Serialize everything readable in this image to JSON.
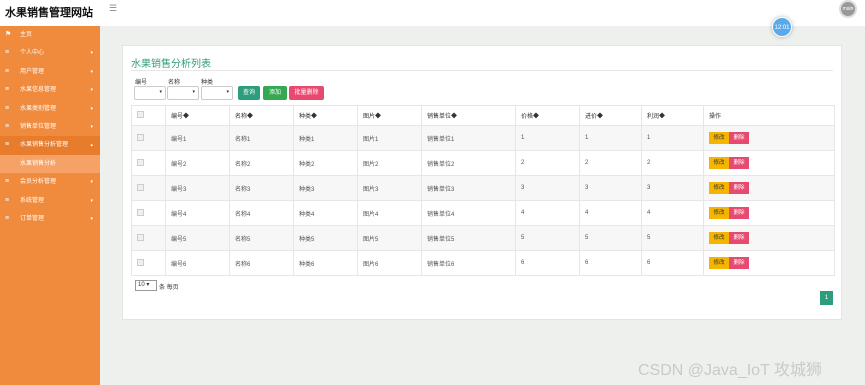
{
  "app": {
    "title": "水果销售管理网站",
    "menu_icon": "hamburger-icon"
  },
  "header": {
    "avatar_text": "main"
  },
  "clock": {
    "text": "12:01"
  },
  "sidebar": {
    "items": [
      {
        "icon": "flag-icon",
        "label": "主页",
        "has_arrow": false
      },
      {
        "icon": "list-icon",
        "label": "个人中心",
        "has_arrow": true
      },
      {
        "icon": "list-icon",
        "label": "用户管理",
        "has_arrow": true
      },
      {
        "icon": "list-icon",
        "label": "水果信息管理",
        "has_arrow": true
      },
      {
        "icon": "list-icon",
        "label": "水果类别管理",
        "has_arrow": true
      },
      {
        "icon": "list-icon",
        "label": "销售单位管理",
        "has_arrow": true
      },
      {
        "icon": "list-icon",
        "label": "水果销售分析管理",
        "has_arrow": true
      },
      {
        "icon": "list-icon",
        "label": "会员分析管理",
        "has_arrow": true
      },
      {
        "icon": "list-icon",
        "label": "系统管理",
        "has_arrow": true
      },
      {
        "icon": "list-icon",
        "label": "订单管理",
        "has_arrow": true
      }
    ],
    "submenu_label": "水果销售分析"
  },
  "panel": {
    "title": "水果销售分析列表"
  },
  "filters": {
    "labels": [
      "编号",
      "名称",
      "种类"
    ],
    "query": "查询",
    "add": "添加",
    "batch_delete": "批量删除"
  },
  "table": {
    "headers": [
      "编号◆",
      "名称◆",
      "种类◆",
      "图片◆",
      "销售单位◆",
      "价格◆",
      "进价◆",
      "利润◆",
      "操作"
    ],
    "rows": [
      [
        "编号1",
        "名称1",
        "种类1",
        "图片1",
        "销售单位1",
        "1",
        "1",
        "1"
      ],
      [
        "编号2",
        "名称2",
        "种类2",
        "图片2",
        "销售单位2",
        "2",
        "2",
        "2"
      ],
      [
        "编号3",
        "名称3",
        "种类3",
        "图片3",
        "销售单位3",
        "3",
        "3",
        "3"
      ],
      [
        "编号4",
        "名称4",
        "种类4",
        "图片4",
        "销售单位4",
        "4",
        "4",
        "4"
      ],
      [
        "编号5",
        "名称5",
        "种类5",
        "图片5",
        "销售单位5",
        "5",
        "5",
        "5"
      ],
      [
        "编号6",
        "名称6",
        "种类6",
        "图片6",
        "销售单位6",
        "6",
        "6",
        "6"
      ]
    ],
    "edit_label": "修改",
    "delete_label": "删除"
  },
  "pagination": {
    "page_size": "10",
    "page_size_suffix": "条 每页",
    "current_page": "1"
  },
  "watermark": "CSDN @Java_IoT 攻城狮",
  "colors": {
    "sidebar": "#f08a3c",
    "accent": "#2e9d7e",
    "danger": "#e84a6f",
    "warning": "#f4b400"
  }
}
